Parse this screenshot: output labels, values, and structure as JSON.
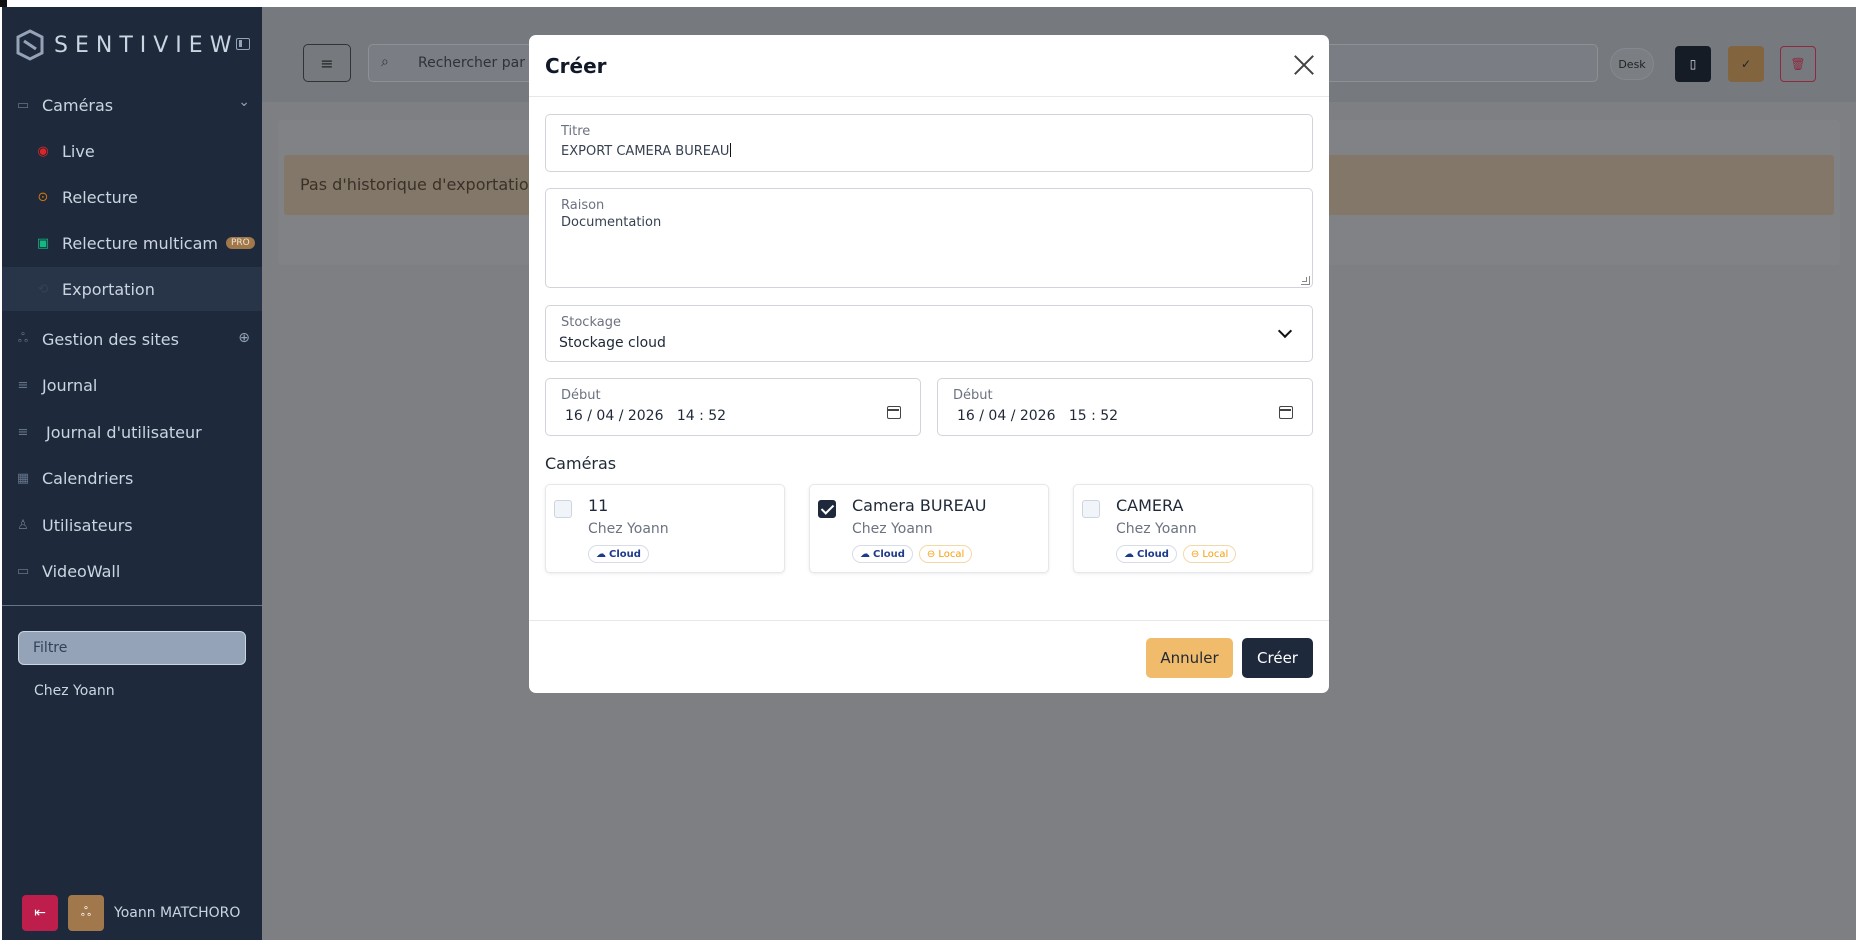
{
  "app": {
    "brand": "SENTIVIEW"
  },
  "sidebar": {
    "items": [
      {
        "label": "Caméras",
        "icon": "camera-icon"
      },
      {
        "label": "Live",
        "icon": "live-icon"
      },
      {
        "label": "Relecture",
        "icon": "play-icon"
      },
      {
        "label": "Relecture multicam",
        "icon": "multicam-icon",
        "badge": "PRO"
      },
      {
        "label": "Exportation",
        "icon": "export-icon"
      },
      {
        "label": "Gestion des sites",
        "icon": "sites-icon"
      },
      {
        "label": "Journal",
        "icon": "list-icon"
      },
      {
        "label": "Journal d'utilisateur",
        "icon": "list-icon"
      },
      {
        "label": "Calendriers",
        "icon": "calendar-icon"
      },
      {
        "label": "Utilisateurs",
        "icon": "user-icon"
      },
      {
        "label": "VideoWall",
        "icon": "monitor-icon"
      }
    ],
    "filter_placeholder": "Filtre",
    "tree_item": "Chez Yoann",
    "user_name": "Yoann MATCHORO"
  },
  "topbar": {
    "search_placeholder": "Rechercher par c",
    "chip": "Desk"
  },
  "main": {
    "alert": "Pas d'historique d'exportatio"
  },
  "modal": {
    "title": "Créer",
    "fields": {
      "title_label": "Titre",
      "title_value": "EXPORT CAMERA BUREAU",
      "reason_label": "Raison",
      "reason_value": "Documentation",
      "storage_label": "Stockage",
      "storage_value": "Stockage cloud",
      "start_label": "Début",
      "start_value": "16 / 04 / 2026   14 : 52",
      "end_label": "Début",
      "end_value": "16 / 04 / 2026   15 : 52"
    },
    "cameras_title": "Caméras",
    "cameras": [
      {
        "name": "11",
        "site": "Chez Yoann",
        "checked": false,
        "cloud": "Cloud"
      },
      {
        "name": "Camera BUREAU",
        "site": "Chez Yoann",
        "checked": true,
        "cloud": "Cloud",
        "local": "Local"
      },
      {
        "name": "CAMERA",
        "site": "Chez Yoann",
        "checked": false,
        "cloud": "Cloud",
        "local": "Local"
      }
    ],
    "cancel_label": "Annuler",
    "create_label": "Créer"
  },
  "colors": {
    "sidebar_bg": "#1e293b",
    "accent_gold": "#f0bb6a",
    "danger": "#be1e4b",
    "primary_dark": "#1e293b"
  }
}
